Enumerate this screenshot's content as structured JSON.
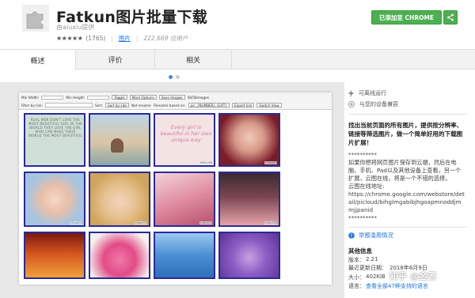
{
  "header": {
    "title": "Fatkun图片批量下载",
    "author": "由aiuxiu提供",
    "rating_stars": "★★★★★",
    "rating_count": "(1765)",
    "category": "图片",
    "users": "222,669 位用户",
    "added_button": "已添加至 CHROME"
  },
  "tabs": [
    {
      "label": "概述"
    },
    {
      "label": "评价"
    },
    {
      "label": "相关"
    }
  ],
  "screenshot": {
    "toolbar": {
      "min_width_label": "Min Width:",
      "min_height_label": "Min Height:",
      "toggle_label": "Toggle",
      "more_options_label": "More Options",
      "save_images_label": "Save Images",
      "count_label": "58/58images",
      "filter_label": "Filter by link:",
      "sort_label": "Sort:",
      "sort_value": "Sort by site",
      "rename_label": "Not rename",
      "rename_options": "Filename based on:",
      "filename_pattern": "pic_{NUMBER}.{EXT}",
      "export_label": "Export link",
      "switch_view_label": "Switch View"
    },
    "thumbnails": [
      {
        "caption": "",
        "text": "REAL MEN DON'T LOVE THE MOST BEAUTIFUL GIRL IN THE WORLD THEY LOVE THE GIRL WHO CAN MAKE THEIR WORLD THE MOST BEAUTIFUL"
      },
      {
        "caption": "",
        "text": ""
      },
      {
        "caption": "269x168",
        "text": "Every girl is beautiful in her own unique way"
      },
      {
        "caption": "275x183",
        "text": ""
      },
      {
        "caption": "251x203",
        "text": ""
      },
      {
        "caption": "288x293",
        "text": ""
      },
      {
        "caption": "248x200",
        "text": ""
      },
      {
        "caption": "288x288",
        "text": ""
      },
      {
        "caption": "",
        "text": ""
      },
      {
        "caption": "",
        "text": ""
      },
      {
        "caption": "",
        "text": ""
      },
      {
        "caption": "",
        "text": ""
      }
    ]
  },
  "sidebar": {
    "offline": "可离线运行",
    "compat": "与您的设备兼容",
    "description_bold": "找出当前页面的所有图片，提供按分辨率、链接等筛选图片，做一个简单好用的下载图片扩展！",
    "description": "**********\n如果你想将网页图片保存到云端，然后在电脑、手机、Pad以及其他设备上查看，另一个扩展，云图在线，将是一个不错的选择。\n云图在线地址:\nhttps://chrome.google.com/webstore/detail/picloud/bihglmgabibjhgoapmnoddjmmjjpanid\n**********",
    "report": "举报滥用情况",
    "other_info_title": "其他信息",
    "info": [
      {
        "label": "版本：",
        "value": "2.21"
      },
      {
        "label": "最近更新日期：",
        "value": "2018年6月9日"
      },
      {
        "label": "大小：",
        "value": "402KiB"
      },
      {
        "label": "语言：",
        "value": "查看全部47种支持的语言"
      }
    ]
  },
  "watermark": "知乎 @金源"
}
